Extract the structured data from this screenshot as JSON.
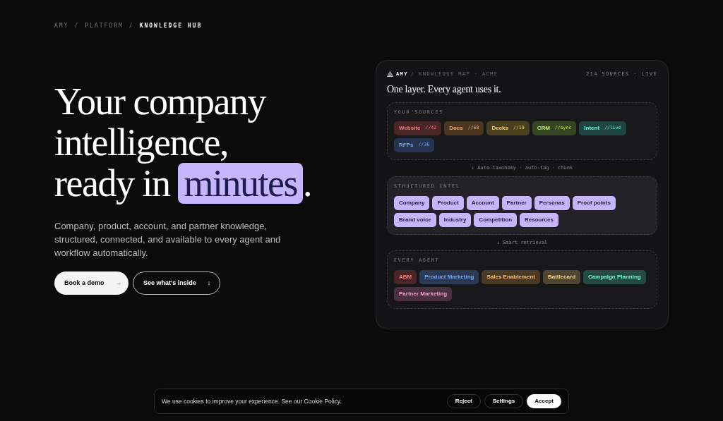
{
  "breadcrumb": [
    {
      "label": "AMY",
      "current": false
    },
    {
      "label": "PLATFORM",
      "current": false
    },
    {
      "label": "KNOWLEDGE HUB",
      "current": true
    }
  ],
  "breadcrumb_separator": "/",
  "hero": {
    "title_lines": [
      "Your company",
      "intelligence,"
    ],
    "title_last": "ready in",
    "title_highlight": "minutes",
    "title_end": ".",
    "description": "Company, product, account, and partner knowledge, structured, connected, and available to every agent and workflow automatically.",
    "buttons": [
      {
        "kind": "primary",
        "label": "Book a demo",
        "icon": "→"
      },
      {
        "kind": "outline",
        "label": "See what's inside",
        "icon": "↓"
      }
    ]
  },
  "card": {
    "brand": "AMY",
    "path": "/ KNOWLEDGE MAP · ACME",
    "status": "214 SOURCES · LIVE",
    "title": "One layer. Every agent uses it.",
    "sections": [
      {
        "label": "YOUR SOURCES",
        "tags": [
          {
            "name": "Website",
            "meta": "//42",
            "color": "#4a2525"
          },
          {
            "name": "Docs",
            "meta": "//68",
            "color": "#4a3520"
          },
          {
            "name": "Decks",
            "meta": "//19",
            "color": "#4a4020"
          },
          {
            "name": "CRM",
            "meta": "//sync",
            "color": "#35451f"
          },
          {
            "name": "Intent",
            "meta": "//live",
            "color": "#1f4540"
          },
          {
            "name": "RFPs",
            "meta": "//36",
            "color": "#25354f"
          }
        ],
        "solid": false
      },
      {
        "connector": "↓ Auto-taxonomy · auto-tag · chunk",
        "label": "STRUCTURED INTEL",
        "solid": true,
        "tags": [
          {
            "name": "Company"
          },
          {
            "name": "Product"
          },
          {
            "name": "Account"
          },
          {
            "name": "Partner"
          },
          {
            "name": "Personas"
          },
          {
            "name": "Proof points"
          },
          {
            "name": "Brand voice"
          },
          {
            "name": "Industry"
          },
          {
            "name": "Competition"
          },
          {
            "name": "Resources"
          }
        ]
      },
      {
        "connector": "↓ Smart retrieval",
        "label": "EVERY AGENT",
        "tags": [
          {
            "name": "ABM",
            "color": "#4a2525"
          },
          {
            "name": "Product Marketing",
            "color": "#2a3a55"
          },
          {
            "name": "Sales Enablement",
            "color": "#4a3a25"
          },
          {
            "name": "Battlecard",
            "color": "#4f4530"
          },
          {
            "name": "Campaign Planning",
            "color": "#254a40"
          },
          {
            "name": "Partner Marketing",
            "color": "#4a3040"
          }
        ],
        "solid": false
      }
    ]
  },
  "cookie_banner": {
    "text": "We use cookies to improve your experience. See our Cookie Policy.",
    "buttons": [
      {
        "kind": "outline",
        "label": "Reject"
      },
      {
        "kind": "outline",
        "label": "Settings"
      },
      {
        "kind": "primary",
        "label": "Accept"
      }
    ]
  }
}
